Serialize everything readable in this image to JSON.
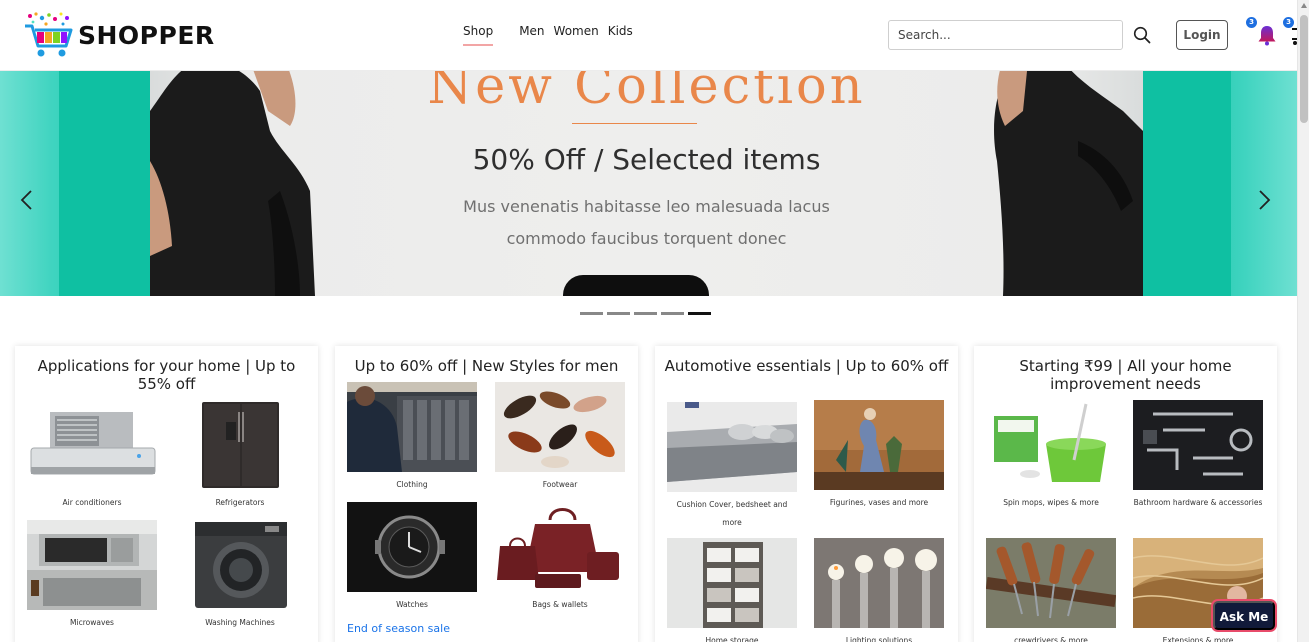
{
  "brand": {
    "name": "SHOPPER"
  },
  "nav": {
    "items": [
      "Shop",
      "Men",
      "Women",
      "Kids"
    ],
    "active": "Shop"
  },
  "search": {
    "placeholder": "Search..."
  },
  "header": {
    "login_label": "Login",
    "notification_count": "3",
    "cart_count": "3"
  },
  "hero": {
    "title": "New Collection",
    "subtitle": "50% Off / Selected items",
    "desc_line1": "Mus venenatis habitasse leo malesuada lacus",
    "desc_line2": "commodo faucibus torquent donec",
    "slide_count": 5,
    "active_slide": 5
  },
  "cards": [
    {
      "title": "Applications for your home | Up to 55% off",
      "tiles": [
        "Air conditioners",
        "Refrigerators",
        "Microwaves",
        "Washing Machines"
      ]
    },
    {
      "title": "Up to 60% off | New Styles for men",
      "tiles": [
        "Clothing",
        "Footwear",
        "Watches",
        "Bags & wallets"
      ],
      "link": "End of season sale"
    },
    {
      "title": "Automotive essentials | Up to 60% off",
      "tiles": [
        "Cushion Cover, bedsheet and more",
        "Figurines, vases and more",
        "Home storage",
        "Lighting solutions"
      ]
    },
    {
      "title": "Starting ₹99 | All your home improvement needs",
      "tiles": [
        "Spin mops, wipes & more",
        "Bathroom hardware & accessories",
        "crewdrivers & more",
        "Extensions & more"
      ]
    }
  ],
  "chat": {
    "label": "Ask Me"
  },
  "colors": {
    "accent_teal": "#10c1a4",
    "hero_orange": "#e9874a",
    "link_blue": "#1a73e8",
    "badge_blue": "#1e6fe0"
  }
}
